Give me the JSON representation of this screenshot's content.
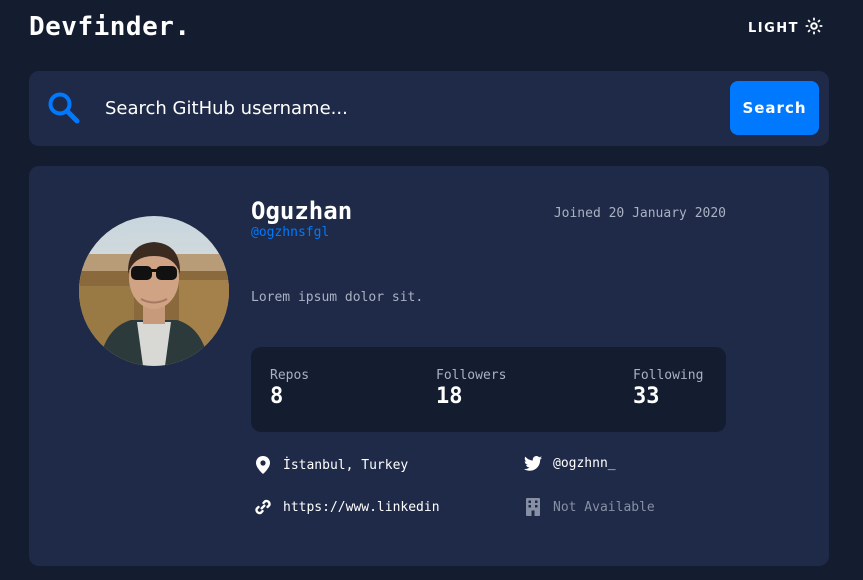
{
  "header": {
    "logo": "Devfinder.",
    "theme_label": "LIGHT",
    "theme_icon": "sun-icon"
  },
  "search": {
    "placeholder": "Search GitHub username...",
    "button_label": "Search",
    "icon": "search-icon"
  },
  "profile": {
    "name": "Oguzhan",
    "login": "@ogzhnsfgl",
    "joined": "Joined 20 January 2020",
    "bio": "Lorem ipsum dolor sit.",
    "stats": [
      {
        "label": "Repos",
        "value": "8"
      },
      {
        "label": "Followers",
        "value": "18"
      },
      {
        "label": "Following",
        "value": "33"
      }
    ],
    "links": {
      "location": "İstanbul, Turkey",
      "twitter": "@ogzhnn_",
      "blog": "https://www.linkedin",
      "company": "Not Available"
    }
  },
  "colors": {
    "background": "#141d2f",
    "card": "#1e2a47",
    "accent": "#0079ff",
    "muted": "#a9b1c2"
  }
}
